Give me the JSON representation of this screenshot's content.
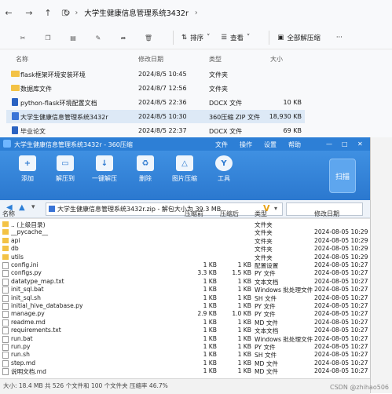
{
  "explorer": {
    "path": [
      "大学生健康信息管理系统3432r"
    ],
    "toolbar": {
      "sort_label": "排序",
      "view_label": "查看",
      "extract_all_label": "全部解压缩",
      "more_label": "···"
    },
    "columns": {
      "name": "名称",
      "modified": "修改日期",
      "type": "类型",
      "size": "大小"
    },
    "rows": [
      {
        "name": "flask框架环境安装环境",
        "date": "2024/8/5 10:45",
        "type": "文件夹",
        "size": "",
        "icon": "folder-icon",
        "selected": false
      },
      {
        "name": "数据库文件",
        "date": "2024/8/7 12:56",
        "type": "文件夹",
        "size": "",
        "icon": "folder-icon",
        "selected": false
      },
      {
        "name": "python-flask环境配置文档",
        "date": "2024/8/5 22:36",
        "type": "DOCX 文件",
        "size": "10 KB",
        "icon": "docx-icon",
        "selected": false
      },
      {
        "name": "大学生健康信息管理系统3432r",
        "date": "2024/8/5 10:30",
        "type": "360压缩 ZIP 文件",
        "size": "18,930 KB",
        "icon": "zip-icon",
        "selected": true
      },
      {
        "name": "毕业论文",
        "date": "2024/8/5 22:37",
        "type": "DOCX 文件",
        "size": "69 KB",
        "icon": "docx-icon",
        "selected": false
      }
    ]
  },
  "zipwin": {
    "title": "大学生健康信息管理系统3432r - 360压缩",
    "menus": [
      "文件",
      "操作",
      "设置",
      "帮助"
    ],
    "ribbon": [
      "添加",
      "解压到",
      "一键解压",
      "删除",
      "图片压缩",
      "工具"
    ],
    "scan_label": "扫描",
    "location": "大学生健康信息管理系统3432r.zip - 解包大小为 39.3 MB",
    "columns": {
      "name": "名称",
      "packed": "压缩前",
      "compressed": "压缩后",
      "type": "类型",
      "modified": "修改日期"
    },
    "rows": [
      {
        "name": ".. (上级目录)",
        "packed": "",
        "comp": "",
        "type": "文件夹",
        "date": "",
        "icon": "folder"
      },
      {
        "name": "__pycache__",
        "packed": "",
        "comp": "",
        "type": "文件夹",
        "date": "2024-08-05 10:29",
        "icon": "folder"
      },
      {
        "name": "api",
        "packed": "",
        "comp": "",
        "type": "文件夹",
        "date": "2024-08-05 10:29",
        "icon": "folder"
      },
      {
        "name": "db",
        "packed": "",
        "comp": "",
        "type": "文件夹",
        "date": "2024-08-05 10:29",
        "icon": "folder"
      },
      {
        "name": "utils",
        "packed": "",
        "comp": "",
        "type": "文件夹",
        "date": "2024-08-05 10:29",
        "icon": "folder"
      },
      {
        "name": "config.ini",
        "packed": "1 KB",
        "comp": "1 KB",
        "type": "配置设置",
        "date": "2024-08-05 10:27",
        "icon": "file"
      },
      {
        "name": "configs.py",
        "packed": "3.3 KB",
        "comp": "1.5 KB",
        "type": "PY 文件",
        "date": "2024-08-05 10:27",
        "icon": "file"
      },
      {
        "name": "datatype_map.txt",
        "packed": "1 KB",
        "comp": "1 KB",
        "type": "文本文档",
        "date": "2024-08-05 10:27",
        "icon": "file"
      },
      {
        "name": "init_sql.bat",
        "packed": "1 KB",
        "comp": "1 KB",
        "type": "Windows 批处理文件",
        "date": "2024-08-05 10:27",
        "icon": "file"
      },
      {
        "name": "init_sql.sh",
        "packed": "1 KB",
        "comp": "1 KB",
        "type": "SH 文件",
        "date": "2024-08-05 10:27",
        "icon": "file"
      },
      {
        "name": "initial_hive_database.py",
        "packed": "1 KB",
        "comp": "1 KB",
        "type": "PY 文件",
        "date": "2024-08-05 10:27",
        "icon": "file"
      },
      {
        "name": "manage.py",
        "packed": "2.9 KB",
        "comp": "1.0 KB",
        "type": "PY 文件",
        "date": "2024-08-05 10:27",
        "icon": "file"
      },
      {
        "name": "readme.md",
        "packed": "1 KB",
        "comp": "1 KB",
        "type": "MD 文件",
        "date": "2024-08-05 10:27",
        "icon": "file"
      },
      {
        "name": "requirements.txt",
        "packed": "1 KB",
        "comp": "1 KB",
        "type": "文本文档",
        "date": "2024-08-05 10:27",
        "icon": "file"
      },
      {
        "name": "run.bat",
        "packed": "1 KB",
        "comp": "1 KB",
        "type": "Windows 批处理文件",
        "date": "2024-08-05 10:27",
        "icon": "file"
      },
      {
        "name": "run.py",
        "packed": "1 KB",
        "comp": "1 KB",
        "type": "PY 文件",
        "date": "2024-08-05 10:27",
        "icon": "file"
      },
      {
        "name": "run.sh",
        "packed": "1 KB",
        "comp": "1 KB",
        "type": "SH 文件",
        "date": "2024-08-05 10:27",
        "icon": "file"
      },
      {
        "name": "step.md",
        "packed": "1 KB",
        "comp": "1 KB",
        "type": "MD 文件",
        "date": "2024-08-05 10:27",
        "icon": "file"
      },
      {
        "name": "说明文档.md",
        "packed": "1 KB",
        "comp": "1 KB",
        "type": "MD 文件",
        "date": "2024-08-05 10:27",
        "icon": "file"
      }
    ],
    "status": "大小: 18.4 MB 共 526 个文件和 100 个文件夹 压缩率 46.7%"
  },
  "watermark": "CSDN @zhihao506",
  "colors": {
    "accent": "#2d7fd6",
    "selection": "#dde9f6"
  }
}
